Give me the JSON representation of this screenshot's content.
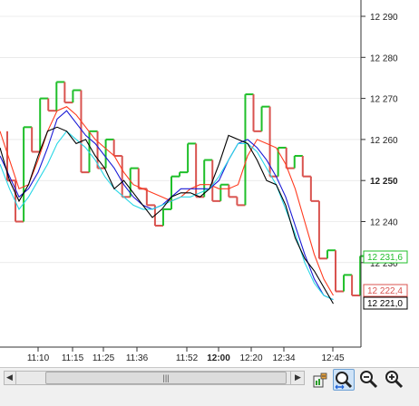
{
  "colors": {
    "bull": "#1fbf2a",
    "bear": "#d9534f",
    "ma_red": "#ff3b1f",
    "ma_blue": "#1a1ad6",
    "ma_cyan": "#29d7e6",
    "ma_black": "#000000",
    "grid": "#dddddd",
    "axis": "#333333"
  },
  "price_axis": {
    "ticks": [
      "12 290",
      "12 280",
      "12 270",
      "12 260",
      "12 250",
      "12 240",
      "12 230"
    ],
    "tick_values": [
      12290,
      12280,
      12270,
      12260,
      12250,
      12240,
      12230
    ],
    "bold_tick": "12 250",
    "tags": [
      {
        "label": "12 231,6",
        "value": 12231.6,
        "color": "#1fbf2a"
      },
      {
        "label": "12 222,4",
        "value": 12222.4,
        "color": "#d9534f"
      },
      {
        "label": "12 221,0",
        "value": 12221.0,
        "color": "#000000"
      }
    ]
  },
  "time_axis": {
    "labels": [
      "11:10",
      "11:15",
      "11:25",
      "11:36",
      "11:52",
      "12:00",
      "12:20",
      "12:34",
      "12:45"
    ],
    "bold": "12:00"
  },
  "chart_data": {
    "type": "line",
    "step": [
      {
        "y": 12250,
        "dir": "down"
      },
      {
        "y": 12240,
        "dir": "down"
      },
      {
        "y": 12263,
        "dir": "up"
      },
      {
        "y": 12257,
        "dir": "down"
      },
      {
        "y": 12270,
        "dir": "up"
      },
      {
        "y": 12267,
        "dir": "down"
      },
      {
        "y": 12274,
        "dir": "up"
      },
      {
        "y": 12269,
        "dir": "down"
      },
      {
        "y": 12272,
        "dir": "up"
      },
      {
        "y": 12252,
        "dir": "down"
      },
      {
        "y": 12262,
        "dir": "up"
      },
      {
        "y": 12253,
        "dir": "down"
      },
      {
        "y": 12260,
        "dir": "up"
      },
      {
        "y": 12256,
        "dir": "down"
      },
      {
        "y": 12246,
        "dir": "down"
      },
      {
        "y": 12253,
        "dir": "up"
      },
      {
        "y": 12248,
        "dir": "down"
      },
      {
        "y": 12244,
        "dir": "down"
      },
      {
        "y": 12239,
        "dir": "down"
      },
      {
        "y": 12243,
        "dir": "up"
      },
      {
        "y": 12251,
        "dir": "up"
      },
      {
        "y": 12252,
        "dir": "up"
      },
      {
        "y": 12259,
        "dir": "up"
      },
      {
        "y": 12246,
        "dir": "down"
      },
      {
        "y": 12255,
        "dir": "up"
      },
      {
        "y": 12245,
        "dir": "down"
      },
      {
        "y": 12249,
        "dir": "up"
      },
      {
        "y": 12246,
        "dir": "down"
      },
      {
        "y": 12244,
        "dir": "down"
      },
      {
        "y": 12271,
        "dir": "up"
      },
      {
        "y": 12262,
        "dir": "down"
      },
      {
        "y": 12268,
        "dir": "up"
      },
      {
        "y": 12251,
        "dir": "down"
      },
      {
        "y": 12258,
        "dir": "up"
      },
      {
        "y": 12253,
        "dir": "down"
      },
      {
        "y": 12256,
        "dir": "up"
      },
      {
        "y": 12251,
        "dir": "down"
      },
      {
        "y": 12245,
        "dir": "down"
      },
      {
        "y": 12231,
        "dir": "down"
      },
      {
        "y": 12233,
        "dir": "up"
      },
      {
        "y": 12223,
        "dir": "down"
      },
      {
        "y": 12227,
        "dir": "up"
      },
      {
        "y": 12222,
        "dir": "down"
      },
      {
        "y": 12231.6,
        "dir": "up"
      }
    ],
    "start_y": 12262,
    "series": [
      {
        "color": "#ff3b1f",
        "values": [
          12262,
          12255,
          12248,
          12249,
          12255,
          12262,
          12267,
          12268,
          12266,
          12263,
          12260,
          12258,
          12256,
          12252,
          12249,
          12248,
          12247,
          12246,
          12245,
          12246,
          12248,
          12249,
          12249,
          12248,
          12248,
          12249,
          12256,
          12260,
          12259,
          12258,
          12254,
          12248,
          12240,
          12232,
          12226,
          12222
        ]
      },
      {
        "color": "#1a1ad6",
        "values": [
          12256,
          12251,
          12246,
          12248,
          12252,
          12258,
          12265,
          12267,
          12264,
          12261,
          12259,
          12256,
          12253,
          12249,
          12246,
          12244,
          12243,
          12244,
          12246,
          12248,
          12248,
          12248,
          12248,
          12250,
          12255,
          12259,
          12260,
          12258,
          12255,
          12251,
          12246,
          12239,
          12232,
          12226,
          12222,
          12221
        ]
      },
      {
        "color": "#29d7e6",
        "values": [
          12254,
          12248,
          12243,
          12246,
          12250,
          12254,
          12259,
          12262,
          12260,
          12258,
          12255,
          12251,
          12248,
          12246,
          12244,
          12243,
          12243,
          12244,
          12245,
          12246,
          12246,
          12247,
          12248,
          12251,
          12255,
          12259,
          12259,
          12257,
          12253,
          12249,
          12243,
          12237,
          12230,
          12225,
          12222,
          12221
        ]
      },
      {
        "color": "#000000",
        "values": [
          12258,
          12250,
          12245,
          12249,
          12256,
          12262,
          12263,
          12262,
          12259,
          12260,
          12256,
          12253,
          12248,
          12250,
          12247,
          12244,
          12241,
          12243,
          12246,
          12247,
          12247,
          12246,
          12248,
          12254,
          12261,
          12260,
          12259,
          12255,
          12250,
          12249,
          12244,
          12236,
          12231,
          12228,
          12224,
          12220
        ]
      }
    ]
  },
  "toolbar": {
    "scroll_left": "◀",
    "scroll_grip": "|||",
    "scroll_right": "▶",
    "icons": [
      "chart-settings-icon",
      "zoom-fit-icon",
      "zoom-out-icon",
      "zoom-in-icon"
    ]
  }
}
